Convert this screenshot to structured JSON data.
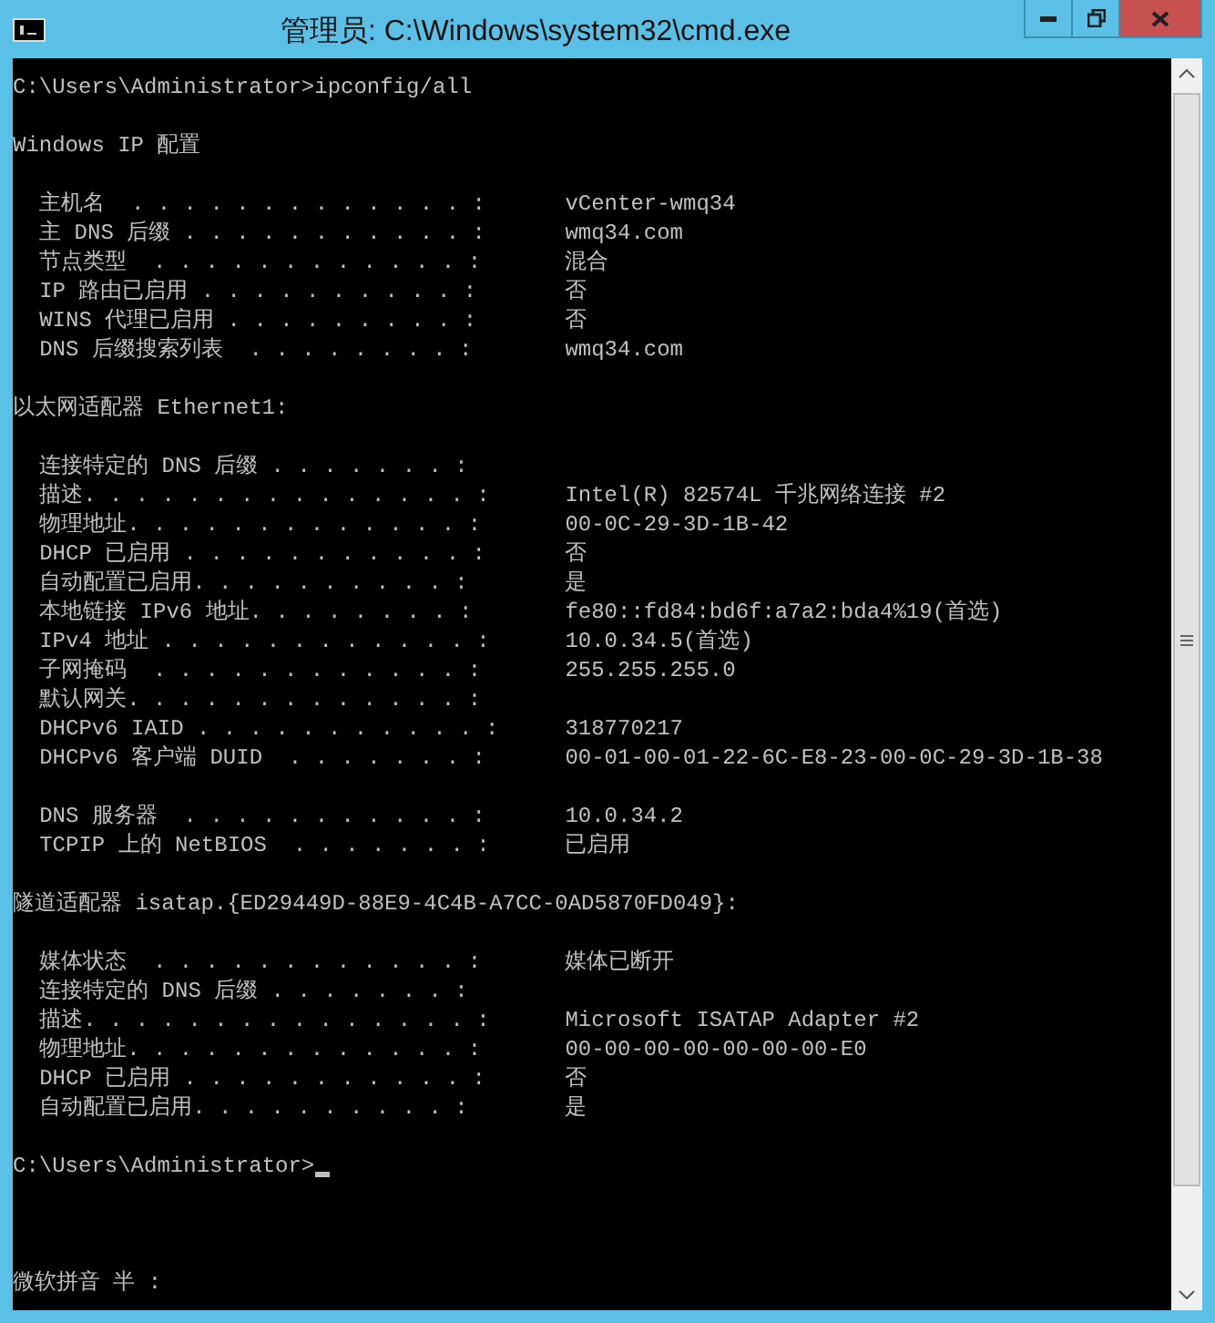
{
  "window": {
    "title": "管理员: C:\\Windows\\system32\\cmd.exe"
  },
  "lines": [
    {
      "kind": "text",
      "text": "C:\\Users\\Administrator>ipconfig/all"
    },
    {
      "kind": "blank"
    },
    {
      "kind": "text",
      "text": "Windows IP 配置"
    },
    {
      "kind": "blank"
    },
    {
      "kind": "pair",
      "label": "   主机名  . . . . . . . . . . . . . :",
      "value": "vCenter-wmq34"
    },
    {
      "kind": "pair",
      "label": "   主 DNS 后缀 . . . . . . . . . . . :",
      "value": "wmq34.com"
    },
    {
      "kind": "pair",
      "label": "   节点类型  . . . . . . . . . . . . :",
      "value": "混合"
    },
    {
      "kind": "pair",
      "label": "   IP 路由已启用 . . . . . . . . . . :",
      "value": "否"
    },
    {
      "kind": "pair",
      "label": "   WINS 代理已启用 . . . . . . . . . :",
      "value": "否"
    },
    {
      "kind": "pair",
      "label": "   DNS 后缀搜索列表  . . . . . . . . :",
      "value": "wmq34.com"
    },
    {
      "kind": "blank"
    },
    {
      "kind": "text",
      "text": "以太网适配器 Ethernet1:"
    },
    {
      "kind": "blank"
    },
    {
      "kind": "pair",
      "label": "   连接特定的 DNS 后缀 . . . . . . . :"
    },
    {
      "kind": "pair",
      "label": "   描述. . . . . . . . . . . . . . . :",
      "value": "Intel(R) 82574L 千兆网络连接 #2"
    },
    {
      "kind": "pair",
      "label": "   物理地址. . . . . . . . . . . . . :",
      "value": "00-0C-29-3D-1B-42"
    },
    {
      "kind": "pair",
      "label": "   DHCP 已启用 . . . . . . . . . . . :",
      "value": "否"
    },
    {
      "kind": "pair",
      "label": "   自动配置已启用. . . . . . . . . . :",
      "value": "是"
    },
    {
      "kind": "pair",
      "label": "   本地链接 IPv6 地址. . . . . . . . :",
      "value": "fe80::fd84:bd6f:a7a2:bda4%19(首选)"
    },
    {
      "kind": "pair",
      "label": "   IPv4 地址 . . . . . . . . . . . . :",
      "value": "10.0.34.5(首选)"
    },
    {
      "kind": "pair",
      "label": "   子网掩码  . . . . . . . . . . . . :",
      "value": "255.255.255.0"
    },
    {
      "kind": "pair",
      "label": "   默认网关. . . . . . . . . . . . . :"
    },
    {
      "kind": "pair",
      "label": "   DHCPv6 IAID . . . . . . . . . . . :",
      "value": "318770217"
    },
    {
      "kind": "pair",
      "label": "   DHCPv6 客户端 DUID  . . . . . . . :",
      "value": "00-01-00-01-22-6C-E8-23-00-0C-29-3D-1B-38"
    },
    {
      "kind": "blank"
    },
    {
      "kind": "pair",
      "label": "   DNS 服务器  . . . . . . . . . . . :",
      "value": "10.0.34.2"
    },
    {
      "kind": "pair",
      "label": "   TCPIP 上的 NetBIOS  . . . . . . . :",
      "value": "已启用"
    },
    {
      "kind": "blank"
    },
    {
      "kind": "text",
      "text": "隧道适配器 isatap.{ED29449D-88E9-4C4B-A7CC-0AD5870FD049}:"
    },
    {
      "kind": "blank"
    },
    {
      "kind": "pair",
      "label": "   媒体状态  . . . . . . . . . . . . :",
      "value": "媒体已断开"
    },
    {
      "kind": "pair",
      "label": "   连接特定的 DNS 后缀 . . . . . . . :"
    },
    {
      "kind": "pair",
      "label": "   描述. . . . . . . . . . . . . . . :",
      "value": "Microsoft ISATAP Adapter #2"
    },
    {
      "kind": "pair",
      "label": "   物理地址. . . . . . . . . . . . . :",
      "value": "00-00-00-00-00-00-00-E0"
    },
    {
      "kind": "pair",
      "label": "   DHCP 已启用 . . . . . . . . . . . :",
      "value": "否"
    },
    {
      "kind": "pair",
      "label": "   自动配置已启用. . . . . . . . . . :",
      "value": "是"
    },
    {
      "kind": "blank"
    },
    {
      "kind": "prompt",
      "text": "C:\\Users\\Administrator>"
    },
    {
      "kind": "blank"
    },
    {
      "kind": "blank"
    },
    {
      "kind": "blank"
    },
    {
      "kind": "text",
      "text": "微软拼音 半 :"
    }
  ]
}
